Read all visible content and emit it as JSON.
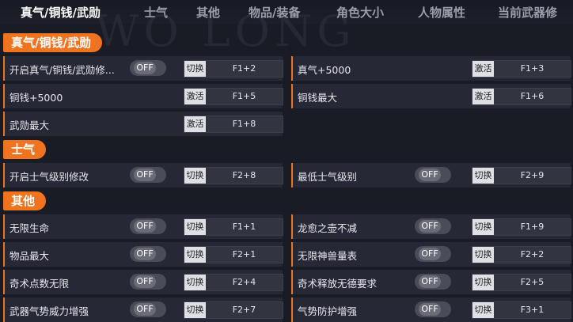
{
  "watermark": "WO LONG",
  "tabs": [
    "真气/铜钱/武勋",
    "士气",
    "其他",
    "物品/装备",
    "角色大小",
    "人物属性",
    "当前武器修"
  ],
  "sections": [
    {
      "title": "真气/铜钱/武勋"
    },
    {
      "title": "士气"
    },
    {
      "title": "其他"
    }
  ],
  "rows": [
    {
      "label": "开启真气/铜钱/武勋修...",
      "toggle": "OFF",
      "action": "切换",
      "keys": "F1+2"
    },
    {
      "label": "真气+5000",
      "action": "激活",
      "keys": "F1+3"
    },
    {
      "label": "铜钱+5000",
      "action": "激活",
      "keys": "F1+5"
    },
    {
      "label": "铜钱最大",
      "action": "激活",
      "keys": "F1+6"
    },
    {
      "label": "武勋最大",
      "action": "激活",
      "keys": "F1+8"
    },
    {
      "label": "开启士气级别修改",
      "toggle": "OFF",
      "action": "切换",
      "keys": "F2+8"
    },
    {
      "label": "最低士气级别",
      "toggle": "OFF",
      "action": "切换",
      "keys": "F2+9"
    },
    {
      "label": "无限生命",
      "toggle": "OFF",
      "action": "切换",
      "keys": "F1+1"
    },
    {
      "label": "龙愈之壶不减",
      "toggle": "OFF",
      "action": "切换",
      "keys": "F1+9"
    },
    {
      "label": "物品最大",
      "toggle": "OFF",
      "action": "切换",
      "keys": "F2+1"
    },
    {
      "label": "无限神兽量表",
      "toggle": "OFF",
      "action": "切换",
      "keys": "F2+2"
    },
    {
      "label": "奇术点数无限",
      "toggle": "OFF",
      "action": "切换",
      "keys": "F2+4"
    },
    {
      "label": "奇术释放无德要求",
      "toggle": "OFF",
      "action": "切换",
      "keys": "F2+5"
    },
    {
      "label": "武器气势威力增强",
      "toggle": "OFF",
      "action": "切换",
      "keys": "F2+7"
    },
    {
      "label": "气势防护增强",
      "toggle": "OFF",
      "action": "切换",
      "keys": "F3+1"
    }
  ]
}
